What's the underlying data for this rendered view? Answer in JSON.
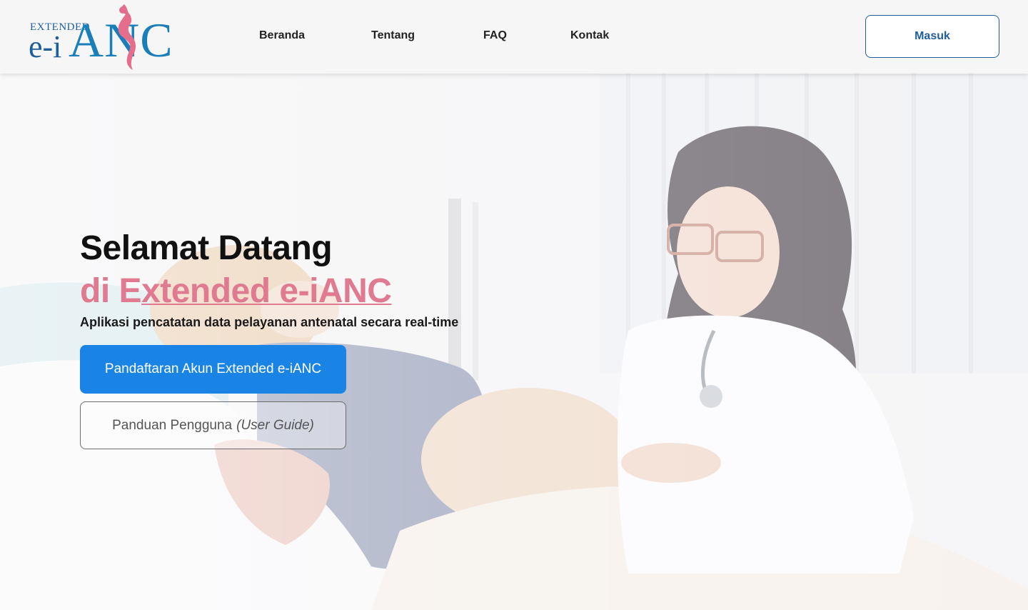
{
  "header": {
    "logo": {
      "extended": "EXTENDED",
      "ei": "e-i",
      "anc": "ANC"
    },
    "nav": [
      {
        "label": "Beranda"
      },
      {
        "label": "Tentang"
      },
      {
        "label": "FAQ"
      },
      {
        "label": "Kontak"
      }
    ],
    "login_label": "Masuk"
  },
  "hero": {
    "title_line1": "Selamat Datang",
    "title_line2_prefix": "di E",
    "title_line2_underlined": "xtended e-iANC",
    "subtitle": "Aplikasi pencatatan data pelayanan antenatal secara real-time",
    "register_label": "Pandaftaran Akun Extended e-iANC",
    "guide_label": "Panduan Pengguna",
    "guide_label_italic": "(User Guide)",
    "image_alt": "Doctor examining a pregnant woman"
  },
  "colors": {
    "brand_blue": "#1f5e9c",
    "accent_pink": "#e07a90",
    "primary_button": "#1a84e6"
  }
}
